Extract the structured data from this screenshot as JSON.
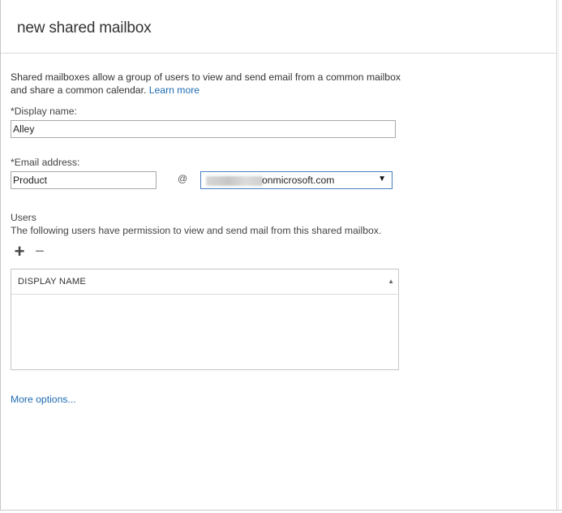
{
  "dialog": {
    "title": "new shared mailbox",
    "description": "Shared mailboxes allow a group of users to view and send email from a common mailbox and share a common calendar.",
    "learn_more": "Learn more"
  },
  "display_name": {
    "label": "*Display name:",
    "value": "Alley"
  },
  "email": {
    "label": "*Email address:",
    "alias": "Product",
    "at": "@",
    "domain_visible": "onmicrosoft.com",
    "dropdown_icon": "triangle-down-icon"
  },
  "users": {
    "heading": "Users",
    "note": "The following users have permission to view and send mail from this shared mailbox.",
    "add_icon": "+",
    "remove_icon": "−",
    "column_header": "DISPLAY NAME",
    "sort_icon": "▲",
    "rows": []
  },
  "more_options": "More options...",
  "colors": {
    "link": "#1e6bb3",
    "focus_border": "#4a7ec1"
  }
}
